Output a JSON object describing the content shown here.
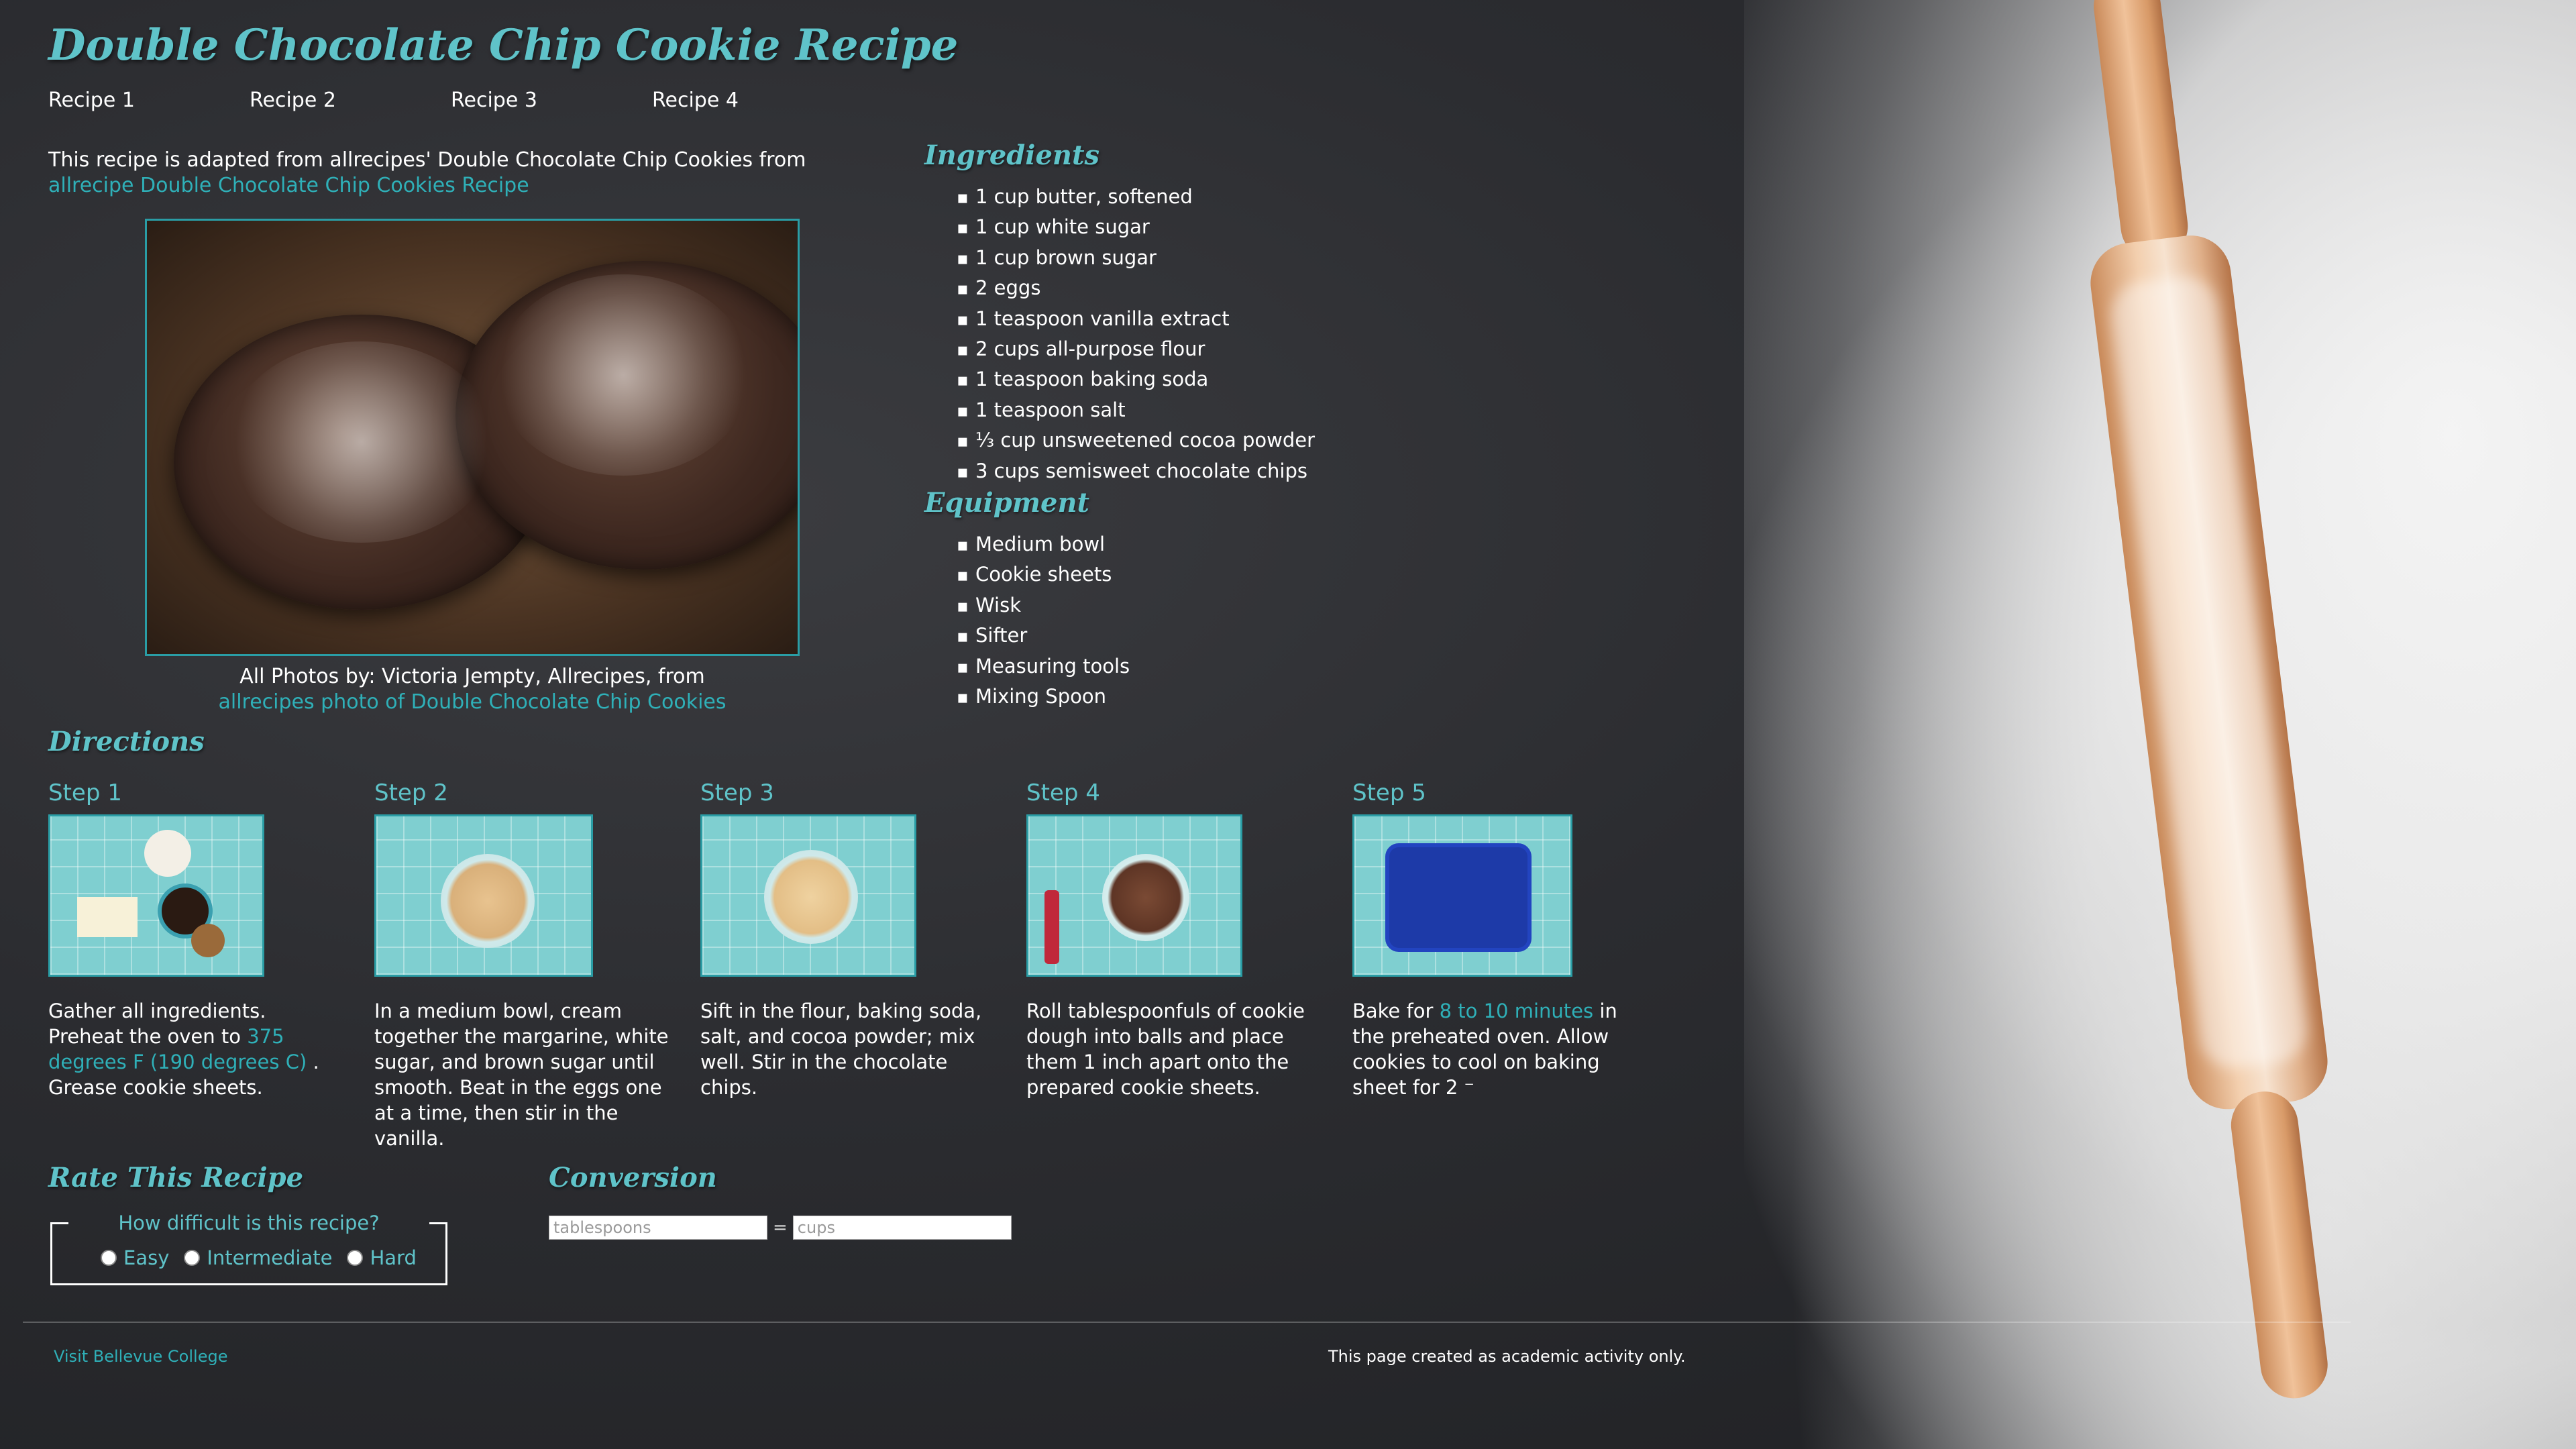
{
  "title": "Double Chocolate Chip Cookie Recipe",
  "nav": [
    "Recipe 1",
    "Recipe 2",
    "Recipe 3",
    "Recipe 4"
  ],
  "intro": {
    "text": "This recipe is adapted from allrecipes' Double Chocolate Chip Cookies from ",
    "link": "allrecipe Double Chocolate Chip Cookies Recipe"
  },
  "caption": {
    "text": "All Photos by: Victoria Jempty, Allrecipes, from",
    "link": "allrecipes photo of Double Chocolate Chip Cookies"
  },
  "ingredients": {
    "title": "Ingredients",
    "items": [
      "1 cup butter, softened",
      "1 cup white sugar",
      "1 cup brown sugar",
      "2 eggs",
      "1 teaspoon vanilla extract",
      "2 cups all-purpose flour",
      "1 teaspoon baking soda",
      "1 teaspoon salt",
      "⅓ cup unsweetened cocoa powder",
      "3 cups semisweet chocolate chips"
    ]
  },
  "equipment": {
    "title": "Equipment",
    "items": [
      "Medium bowl",
      "Cookie sheets",
      "Wisk",
      "Sifter",
      "Measuring tools",
      "Mixing Spoon"
    ]
  },
  "directions": {
    "title": "Directions",
    "steps": [
      {
        "label": "Step 1",
        "pre": "Gather all ingredients. Preheat the oven to ",
        "highlight": "375 degrees F (190 degrees C)",
        "post": " . Grease cookie sheets."
      },
      {
        "label": "Step 2",
        "pre": "In a medium bowl, cream together the margarine, white sugar, and brown sugar until smooth. Beat in the eggs one at a time, then stir in the vanilla.",
        "highlight": "",
        "post": ""
      },
      {
        "label": "Step 3",
        "pre": "Sift in the flour, baking soda, salt, and cocoa powder; mix well. Stir in the chocolate chips.",
        "highlight": "",
        "post": ""
      },
      {
        "label": "Step 4",
        "pre": "Roll tablespoonfuls of cookie dough into balls and place them 1 inch apart onto the prepared cookie sheets.",
        "highlight": "",
        "post": ""
      },
      {
        "label": "Step 5",
        "pre": "Bake for ",
        "highlight": "8 to 10 minutes",
        "post": " in the preheated oven. Allow cookies to cool on baking sheet for 2 ⁻"
      }
    ]
  },
  "rate": {
    "title": "Rate This Recipe",
    "question": "How difficult is this recipe?",
    "options": [
      "Easy",
      "Intermediate",
      "Hard"
    ]
  },
  "conversion": {
    "title": "Conversion",
    "left_placeholder": "tablespoons",
    "equals": "=",
    "right_placeholder": "cups"
  },
  "footer": {
    "left_link": "Visit Bellevue College",
    "right_text": "This page created as academic activity only."
  },
  "colors": {
    "accent": "#5fc3c9",
    "link": "#2fb0b8",
    "background": "#2b2c30"
  }
}
